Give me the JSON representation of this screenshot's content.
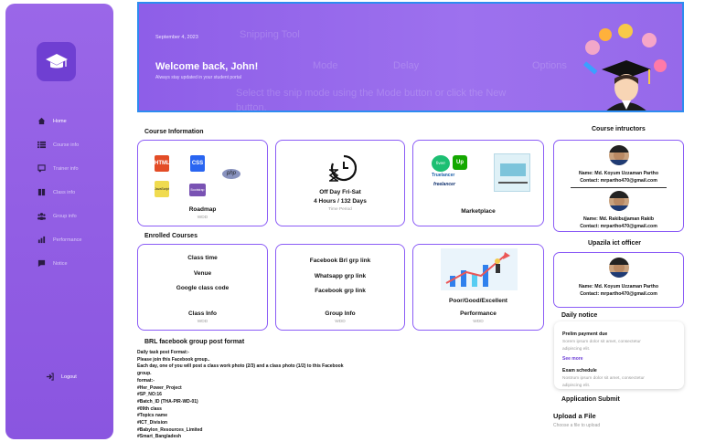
{
  "sidebar": {
    "items": [
      {
        "label": "Home",
        "icon": "home-icon"
      },
      {
        "label": "Course info",
        "icon": "list-icon"
      },
      {
        "label": "Trainer info",
        "icon": "presentation-icon"
      },
      {
        "label": "Class info",
        "icon": "book-icon"
      },
      {
        "label": "Group info",
        "icon": "group-icon"
      },
      {
        "label": "Performance",
        "icon": "bar-chart-icon"
      },
      {
        "label": "Notice",
        "icon": "message-icon"
      }
    ],
    "logout": "Logout"
  },
  "hero": {
    "date": "September 4, 2023",
    "title": "Welcome back, John!",
    "subtitle": "Always stay updated in your student portal",
    "ghost_lines": [
      "Snipping Tool",
      "Mode",
      "Delay",
      "Options",
      "Select the snip mode using the Mode button or click the New",
      "button."
    ]
  },
  "course_information": {
    "title": "Course Information",
    "cards": [
      {
        "title": "Roadmap",
        "sub": "WDD",
        "logos": [
          "HTML",
          "CSS",
          "php",
          "JavaScript",
          "Bootstrap"
        ]
      },
      {
        "title_lines": [
          "Off Day Fri-Sat",
          "4 Hours / 132 Days"
        ],
        "sub": "Time Period"
      },
      {
        "title": "Marketplace",
        "logos": [
          "fiverr",
          "Up",
          "Truelancer",
          "freelancer"
        ]
      }
    ]
  },
  "enrolled_courses": {
    "title": "Enrolled Courses",
    "cards": [
      {
        "lines": [
          "Class time",
          "Venue",
          "Google class code"
        ],
        "title": "Class Info",
        "sub": "WDD"
      },
      {
        "lines": [
          "Facebook Brl grp link",
          "Whatsapp grp link",
          "Facebook grp link"
        ],
        "title": "Group Info",
        "sub": "WDD"
      },
      {
        "lines": [
          "Poor/Good/Excellent"
        ],
        "title": "Performance",
        "sub": "WDD"
      }
    ]
  },
  "instructors": {
    "title": "Course intructors",
    "people": [
      {
        "name": "Name: Md. Koyum Uzzaman Partho",
        "contact": "Contact: mrpartho470@gmail.com"
      },
      {
        "name": "Name: Md. Rakibujjaman Rakib",
        "contact": "Contact: mrpartho470@gmail.com"
      }
    ],
    "ict_title": "Upazila ict officer",
    "ict": {
      "name": "Name: Md. Koyum Uzzaman Partho",
      "contact": "Contact: mrpartho470@gmail.com"
    }
  },
  "daily_notice": {
    "title": "Daily notice",
    "items": [
      {
        "title": "Prelim payment due",
        "body": "Sorem ipsum dolor sit amet, consectetur adipiscing elit.",
        "link": "See more"
      },
      {
        "title": "Exam schedule",
        "body": "Nostrum ipsum dolor sit amet, consectetur adipiscing elit."
      }
    ]
  },
  "post_format": {
    "title": "BRL facebook group post format",
    "lines": [
      "Daily task post Format:-",
      "Please join this Facebook group..",
      "Each day, one of you will post a class work photo (2/3) and a class photo (1/2) to this Facebook",
      "group.",
      "format:-",
      "#Her_Power_Project",
      "#SP_NO:16",
      "#Batch_ID (THA-PIR-WD-01)",
      "#09th class",
      "#Topics name",
      "#ICT_Division",
      "#Babylon_Resources_Limited",
      "#Smart_Bangladesh"
    ]
  },
  "application": {
    "title": "Application Submit",
    "upload_title": "Upload a File",
    "upload_sub": "Choose a file to upload"
  },
  "colors": {
    "accent": "#8b5cf6",
    "hero": "#9468ea",
    "sidebar": "#9160e6"
  }
}
